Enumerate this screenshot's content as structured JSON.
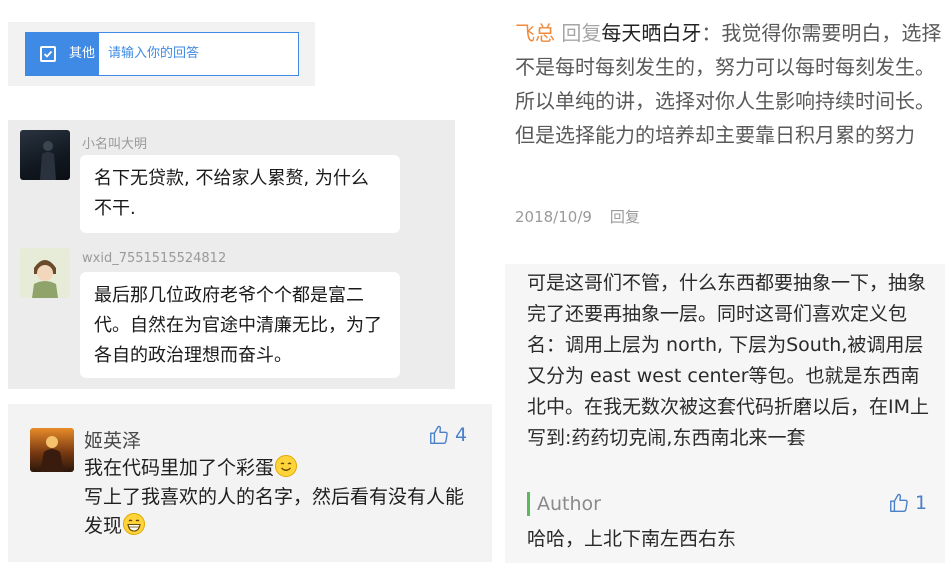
{
  "survey_option": {
    "label": "其他",
    "input_placeholder": "请输入你的回答",
    "accent": "#3f8ae4"
  },
  "chat": {
    "messages": [
      {
        "name": "小名叫大明",
        "text": "名下无贷款, 不给家人累赘, 为什么不干."
      },
      {
        "name": "wxid_7551515524812",
        "text": "最后那几位政府老爷个个都是富二代。自然在为官途中清廉无比，为了各自的政治理想而奋斗。"
      }
    ]
  },
  "comment": {
    "name": "姬英泽",
    "likes": "4",
    "line1": "我在代码里加了个彩蛋",
    "line2": "写上了我喜欢的人的名字，然后看有没有人能发现",
    "emoji_1": "smiling-face",
    "emoji_2": "grinning-face"
  },
  "reply": {
    "author": "飞总",
    "reply_word": "回复",
    "target": "每天晒白牙",
    "text": "：我觉得你需要明白，选择不是每时每刻发生的，努力可以每时每刻发生。所以单纯的讲，选择对你人生影响持续时间长。但是选择能力的培养却主要靠日积月累的努力",
    "date": "2018/10/9",
    "reply_link": "回复"
  },
  "long_comment": {
    "text": "可是这哥们不管，什么东西都要抽象一下，抽象完了还要再抽象一层。同时这哥们喜欢定义包名：调用上层为 north, 下层为South,被调用层又分为  east west center等包。也就是东西南北中。在我无数次被这套代码折磨以后，在IM上写到:药药切克闹,东西南北来一套",
    "author_label": "Author",
    "likes": "1",
    "author_reply": "哈哈，上北下南左西右东"
  }
}
